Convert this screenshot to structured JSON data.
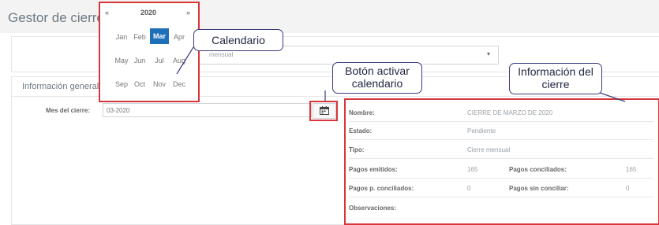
{
  "page_title": "Gestor de cierres",
  "select": {
    "value": "mensual"
  },
  "section_title": "Información general",
  "mes_label": "Mes del cierre:",
  "mes_value": "03-2020",
  "calendar": {
    "prev": "«",
    "year": "2020",
    "next": "»",
    "months": [
      "Jan",
      "Feb",
      "Mar",
      "Apr",
      "May",
      "Jun",
      "Jul",
      "Aug",
      "Sep",
      "Oct",
      "Nov",
      "Dec"
    ],
    "selected": "Mar"
  },
  "callouts": {
    "calendario": "Calendario",
    "boton_line1": "Botón activar",
    "boton_line2": "calendario",
    "info_line1": "Información del",
    "info_line2": "cierre"
  },
  "info": {
    "nombre_label": "Nombre:",
    "nombre_value": "CIERRE DE MARZO DE 2020",
    "estado_label": "Estado:",
    "estado_value": "Pendiente",
    "tipo_label": "Tipo:",
    "tipo_value": "Cierre mensual",
    "emitidos_label": "Pagos emitidos:",
    "emitidos_value": "165",
    "conciliados_label": "Pagos conciliados:",
    "conciliados_value": "165",
    "pconc_label": "Pagos p. conciliados:",
    "pconc_value": "0",
    "sinconc_label": "Pagos sin conciliar:",
    "sinconc_value": "0",
    "obs_label": "Observaciones:"
  },
  "colors": {
    "highlight": "#d8363b",
    "accent": "#1d6fb8",
    "callout_border": "#3a3d7a"
  }
}
